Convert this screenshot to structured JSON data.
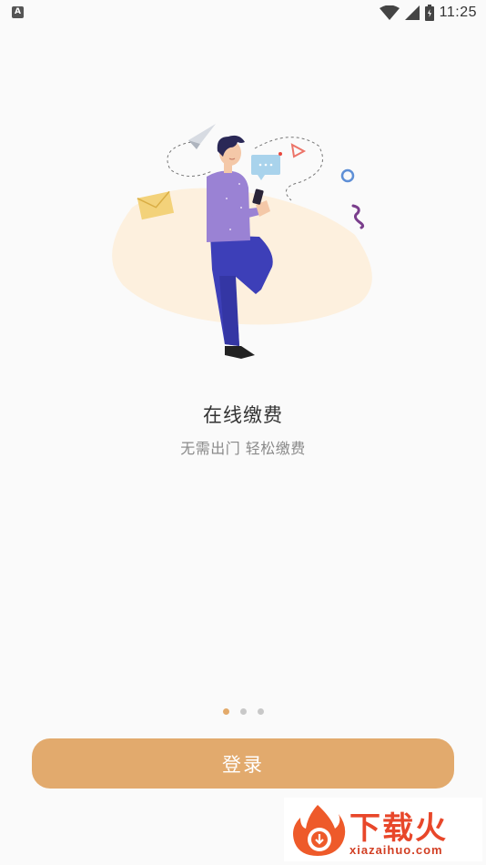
{
  "status_bar": {
    "notification_icon": "A",
    "time": "11:25",
    "icons": [
      "wifi-icon",
      "cell-signal-icon",
      "battery-icon"
    ]
  },
  "onboarding": {
    "title": "在线缴费",
    "subtitle": "无需出门 轻松缴费",
    "illustration": "man-with-phone-illustration",
    "page_count": 3,
    "active_page": 1
  },
  "login_button": {
    "label": "登录"
  },
  "watermark": {
    "brand": "下载火",
    "url": "xiazaihuo.com"
  },
  "colors": {
    "accent": "#e2aa6d",
    "background": "#fafafa",
    "title": "#333333",
    "subtitle": "#8a8a8a",
    "dot_inactive": "#c8c8c8"
  }
}
